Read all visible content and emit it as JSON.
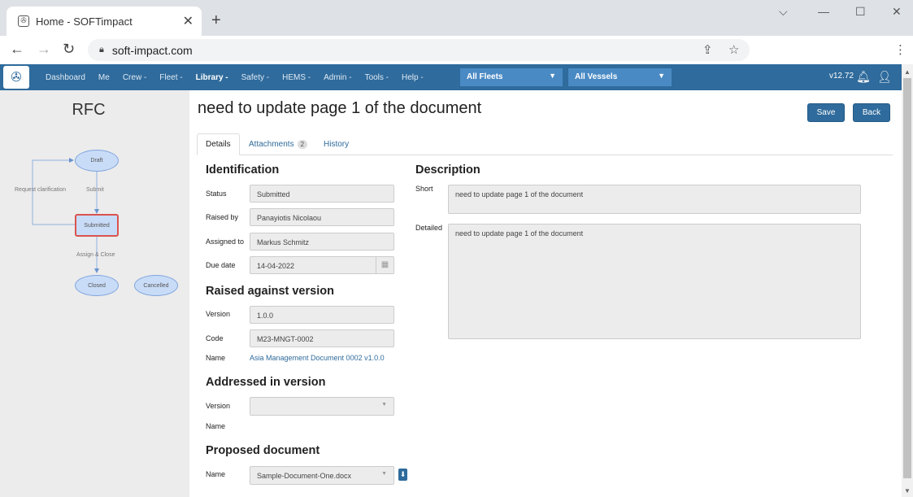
{
  "browser": {
    "tab_title": "Home - SOFTimpact",
    "url": "soft-impact.com"
  },
  "nav": {
    "items": [
      "Dashboard",
      "Me",
      "Crew -",
      "Fleet -",
      "Library -",
      "Safety -",
      "HEMS -",
      "Admin -",
      "Tools -",
      "Help -"
    ],
    "active": "Library -",
    "fleet_select": "All Fleets",
    "vessel_select": "All Vessels",
    "version": "v12.72"
  },
  "workflow": {
    "title": "RFC",
    "nodes": {
      "draft": "Draft",
      "submitted": "Submitted",
      "closed": "Closed",
      "cancelled": "Cancelled"
    },
    "labels": {
      "request_clarification": "Request clarification",
      "submit": "Submit",
      "assign_close": "Assign & Close"
    },
    "current": "Submitted"
  },
  "page": {
    "title": "need to update page 1 of the document",
    "save_label": "Save",
    "back_label": "Back",
    "tabs": {
      "details": "Details",
      "attachments": "Attachments",
      "attachments_count": "2",
      "history": "History"
    }
  },
  "identification": {
    "heading": "Identification",
    "status_label": "Status",
    "status": "Submitted",
    "raised_by_label": "Raised by",
    "raised_by": "Panayiotis Nicolaou",
    "assigned_to_label": "Assigned to",
    "assigned_to": "Markus Schmitz",
    "due_date_label": "Due date",
    "due_date": "14-04-2022"
  },
  "raised_against": {
    "heading": "Raised against version",
    "version_label": "Version",
    "version": "1.0.0",
    "code_label": "Code",
    "code": "M23-MNGT-0002",
    "name_label": "Name",
    "name": "Asia Management Document 0002 v1.0.0"
  },
  "addressed_in": {
    "heading": "Addressed in version",
    "version_label": "Version",
    "version": "",
    "name_label": "Name"
  },
  "proposed": {
    "heading": "Proposed document",
    "name_label": "Name",
    "name": "Sample-Document-One.docx"
  },
  "description": {
    "heading": "Description",
    "short_label": "Short",
    "short": "need to update page 1 of the document",
    "detailed_label": "Detailed",
    "detailed": "need to update page 1 of the document"
  }
}
